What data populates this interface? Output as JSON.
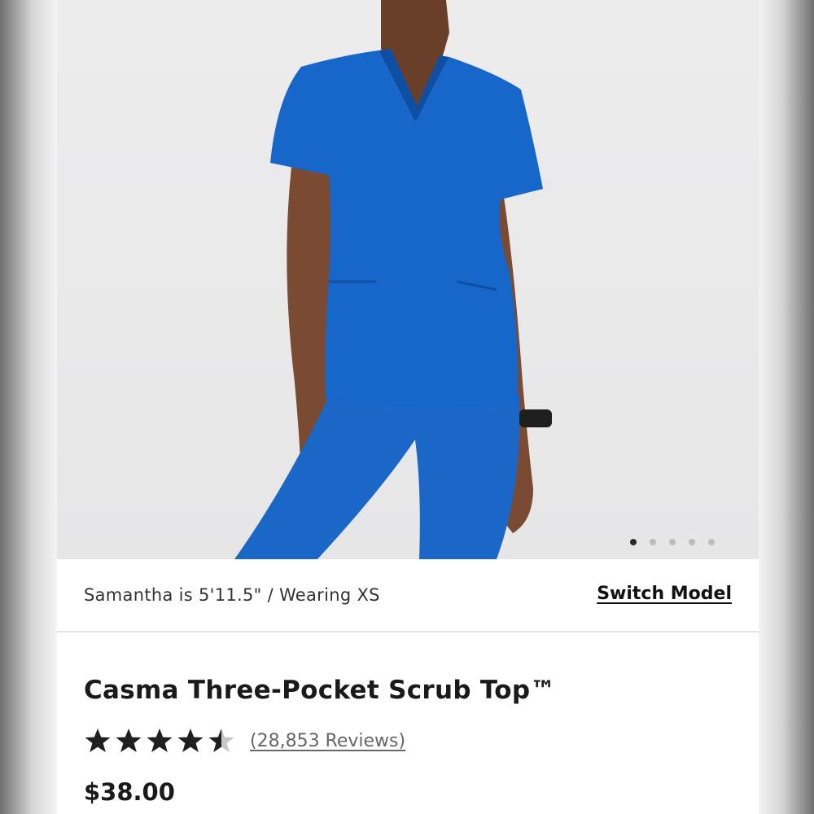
{
  "model_info": {
    "text": "Samantha is 5'11.5\" / Wearing XS",
    "switch_label": "Switch Model"
  },
  "carousel": {
    "slide_count": 5,
    "active_index": 0
  },
  "product": {
    "title": "Casma Three-Pocket Scrub Top™",
    "rating": 4.5,
    "rating_max": 5,
    "reviews_label": "(28,853 Reviews)",
    "price": "$38.00",
    "color": "#1766c9"
  },
  "colors": {
    "star": "#1f1f1f",
    "star_empty": "#c8c8c8"
  }
}
